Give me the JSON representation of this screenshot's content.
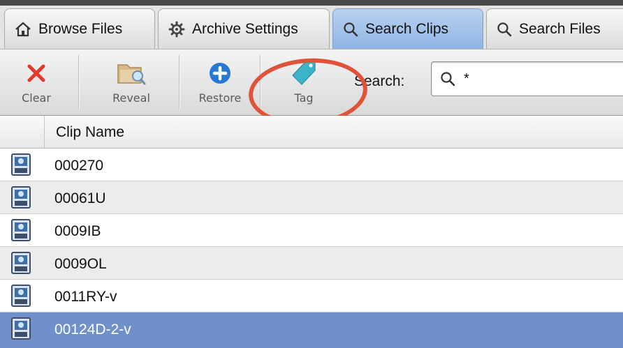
{
  "tabs": [
    {
      "label": "Browse Files",
      "icon": "home-icon",
      "active": false
    },
    {
      "label": "Archive Settings",
      "icon": "gear-icon",
      "active": false
    },
    {
      "label": "Search Clips",
      "icon": "search-icon",
      "active": true
    },
    {
      "label": "Search Files",
      "icon": "search-icon",
      "active": false
    }
  ],
  "toolbar": {
    "clear_label": "Clear",
    "reveal_label": "Reveal",
    "restore_label": "Restore",
    "tag_label": "Tag",
    "search_label": "Search:",
    "search_value": "*"
  },
  "table": {
    "column_header": "Clip Name",
    "rows": [
      "000270",
      "00061U",
      "0009IB",
      "0009OL",
      "0011RY-v",
      "00124D-2-v"
    ],
    "selected_row": "00124D-2-v"
  },
  "colors": {
    "active_tab": "#8fb4e3",
    "selected_row": "#6f90c8",
    "highlight_ring": "#e0533b",
    "clear_icon": "#e03a2a",
    "restore_icon": "#2a78d6",
    "tag_icon": "#3bb3c8"
  }
}
